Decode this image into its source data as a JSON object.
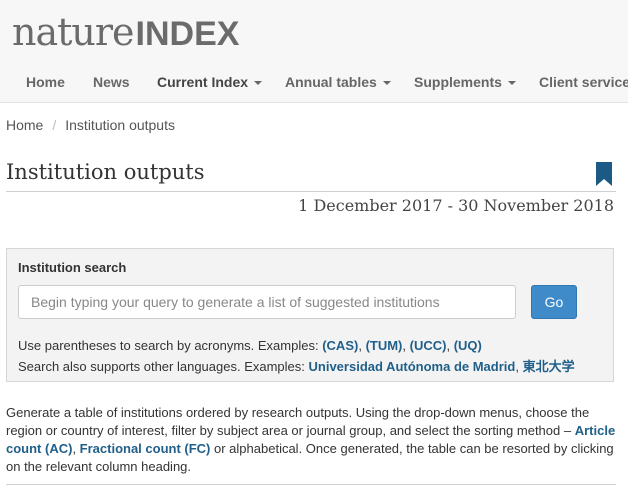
{
  "brand": {
    "nature": "nature",
    "index": "INDEX"
  },
  "nav": {
    "home": "Home",
    "news": "News",
    "current_index": "Current Index",
    "annual_tables": "Annual tables",
    "supplements": "Supplements",
    "client_services": "Client services"
  },
  "breadcrumb": {
    "home": "Home",
    "separator": "/",
    "current": "Institution outputs"
  },
  "page": {
    "title": "Institution outputs",
    "date_range": "1 December 2017 - 30 November 2018",
    "bookmark_icon": "bookmark-icon",
    "bookmark_color": "#1c5a86"
  },
  "search": {
    "title": "Institution search",
    "placeholder": "Begin typing your query to generate a list of suggested institutions",
    "button": "Go",
    "acronyms_prefix": "Use parentheses to search by acronyms. Examples:",
    "acronym_examples": [
      "(CAS)",
      "(TUM)",
      "(UCC)",
      "(UQ)"
    ],
    "languages_prefix": "Search also supports other languages. Examples:",
    "language_examples": [
      "Universidad Autónoma de Madrid",
      "東北大学"
    ]
  },
  "description": {
    "part1": "Generate a table of institutions ordered by research outputs. Using the drop-down menus, choose the region or country of interest, filter by subject area or journal group, and select the sorting method –",
    "article_count": "Article count (AC)",
    "fractional_count": "Fractional count (FC)",
    "part2": "or alphabetical. Once generated, the table can be resorted by clicking on the relevant column heading."
  },
  "colors": {
    "accent": "#3f8ac9",
    "link": "#1f5f8a",
    "bg_panel": "#f3f3f3"
  }
}
